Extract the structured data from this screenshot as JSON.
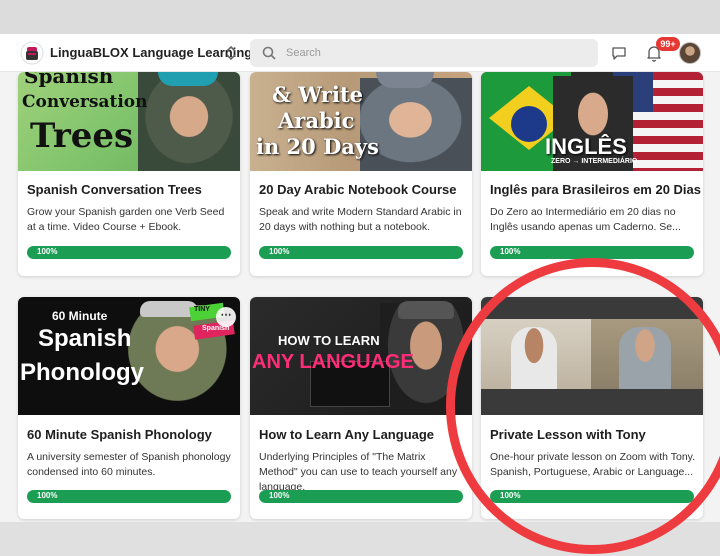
{
  "header": {
    "brand": "LinguaBLOX Language Learning",
    "search_placeholder": "Search",
    "notification_count": "99+"
  },
  "icons": [
    "logo-icon",
    "chevron-updown-icon",
    "search-icon",
    "chat-icon",
    "bell-icon",
    "avatar",
    "more-options-icon"
  ],
  "colors": {
    "progress": "#1b9e54",
    "badge": "#e53935",
    "annotation_circle": "#ee3b3f"
  },
  "courses": [
    {
      "title": "Spanish Conversation Trees",
      "description": "Grow your Spanish garden one Verb Seed at a time. Video Course + Ebook.",
      "progress_label": "100%",
      "progress": 1.0,
      "thumb_text": [
        "Spanish",
        "Conversation",
        "Trees"
      ]
    },
    {
      "title": "20 Day Arabic Notebook Course",
      "description": "Speak and write Modern Standard Arabic in 20 days with nothing but a notebook.",
      "progress_label": "100%",
      "progress": 1.0,
      "thumb_text": [
        "& Write",
        "Arabic",
        "in 20 Days"
      ]
    },
    {
      "title": "Inglês para Brasileiros em 20 Dias",
      "description": "Do Zero ao Intermediário em 20 dias no Inglês usando apenas um Caderno. Se...",
      "progress_label": "100%",
      "progress": 1.0,
      "thumb_text": [
        "INGLÊS",
        "ZERO → INTERMEDIÁRIO"
      ]
    },
    {
      "title": "60 Minute Spanish Phonology",
      "description": "A university semester of Spanish phonology condensed into 60 minutes.",
      "progress_label": "100%",
      "progress": 1.0,
      "thumb_text": [
        "60 Minute",
        "Spanish",
        "Phonology",
        "TINY",
        "Spanish"
      ]
    },
    {
      "title": "How to Learn Any Language",
      "description": "Underlying Principles of \"The Matrix Method\" you can use to teach yourself any language.",
      "progress_label": "100%",
      "progress": 1.0,
      "thumb_text": [
        "HOW TO LEARN",
        "ANY LANGUAGE"
      ]
    },
    {
      "title": "Private Lesson with Tony",
      "description": "One-hour private lesson on Zoom with Tony. Spanish, Portuguese, Arabic or Language...",
      "progress_label": "100%",
      "progress": 1.0,
      "thumb_text": []
    }
  ]
}
